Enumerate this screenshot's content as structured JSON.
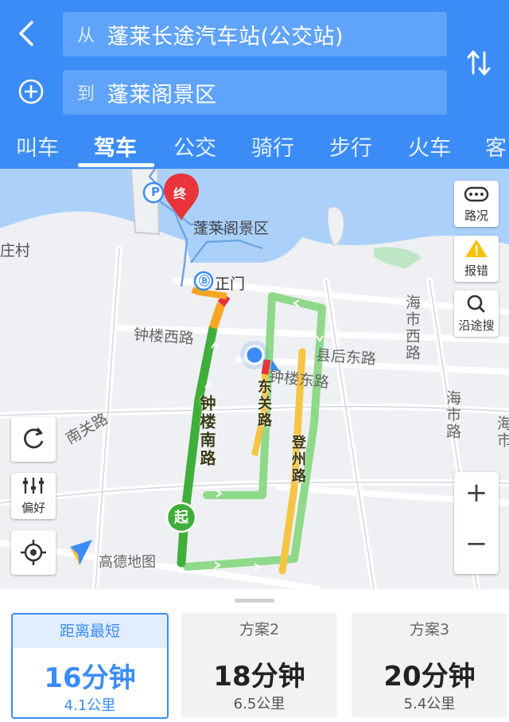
{
  "header": {
    "from_prefix": "从",
    "from_value": "蓬莱长途汽车站(公交站)",
    "to_prefix": "到",
    "to_value": "蓬莱阁景区",
    "brand_color": "#3b8cf6"
  },
  "tabs": [
    {
      "label": "叫车",
      "active": false
    },
    {
      "label": "驾车",
      "active": true
    },
    {
      "label": "公交",
      "active": false
    },
    {
      "label": "骑行",
      "active": false
    },
    {
      "label": "步行",
      "active": false
    },
    {
      "label": "火车",
      "active": false
    },
    {
      "label": "客",
      "active": false
    }
  ],
  "map": {
    "place_labels": {
      "destination": "蓬莱阁景区",
      "gate": "正门",
      "village": "庄村",
      "parking_glyph": "P",
      "end_marker": "终",
      "start_marker": "起",
      "logo": "高德地图"
    },
    "roads": {
      "zhonglou_west": "钟楼西路",
      "xianhou_east": "县后东路",
      "zhonglou_east": "钟楼东路",
      "nanguan": "南关路",
      "haishi_west": "海市西路",
      "haishi": "海市路",
      "hai_partial": "海市",
      "zhonglou_south": "钟楼南路",
      "dongguan": "东关路",
      "dengzhou": "登州路"
    },
    "route_colors": {
      "smooth": "#59c14f",
      "slow": "#f5c442",
      "congested": "#e8343a",
      "alt": "#8fd98a"
    }
  },
  "controls": {
    "traffic": "路况",
    "report": "报错",
    "along_search": "沿途搜",
    "preference": "偏好",
    "zoom_in": "+",
    "zoom_out": "−"
  },
  "routes": [
    {
      "name": "距离最短",
      "time": "16分钟",
      "distance": "4.1公里",
      "selected": true
    },
    {
      "name": "方案2",
      "time": "18分钟",
      "distance": "6.5公里",
      "selected": false
    },
    {
      "name": "方案3",
      "time": "20分钟",
      "distance": "5.4公里",
      "selected": false
    }
  ]
}
